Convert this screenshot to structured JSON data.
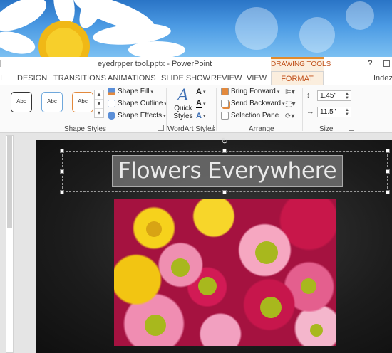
{
  "window": {
    "title": "eyedrpper tool.pptx - PowerPoint",
    "context_tab_group": "DRAWING TOOLS",
    "help": "?"
  },
  "tabs": [
    "DESIGN",
    "TRANSITIONS",
    "ANIMATIONS",
    "SLIDE SHOW",
    "REVIEW",
    "VIEW",
    "FORMAT"
  ],
  "active_tab": "FORMAT",
  "user": "Indezine",
  "ribbon": {
    "shape_styles": {
      "gallery": [
        "Abc",
        "Abc",
        "Abc"
      ],
      "shape_fill": "Shape Fill",
      "shape_outline": "Shape Outline",
      "shape_effects": "Shape Effects",
      "label": "Shape Styles"
    },
    "wordart_styles": {
      "quick_styles": "Quick Styles",
      "label": "WordArt Styles"
    },
    "arrange": {
      "bring_forward": "Bring Forward",
      "send_backward": "Send Backward",
      "selection_pane": "Selection Pane",
      "label": "Arrange"
    },
    "size": {
      "height": "1.45\"",
      "width": "11.5\"",
      "label": "Size"
    }
  },
  "slide": {
    "title": "Flowers Everywhere"
  },
  "colors": {
    "accent": "#c0501a",
    "contextual_tab_bg": "#fbeede",
    "slide_bg": "#1c1c1c"
  }
}
